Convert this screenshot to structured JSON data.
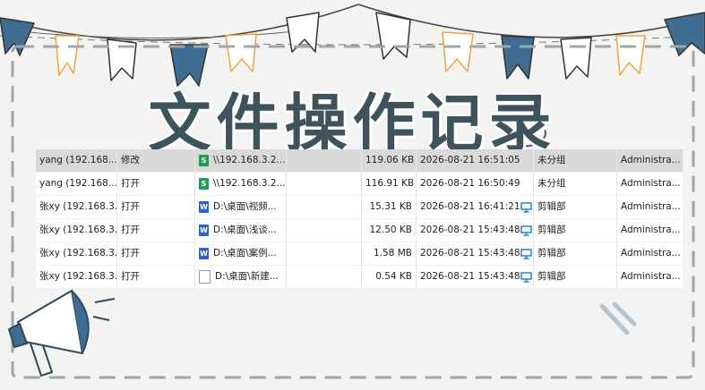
{
  "title": "文件操作记录",
  "colors": {
    "title": "#3e535b",
    "flag_dark": "#3f6d92",
    "flag_orange": "#f2a43f",
    "dash": "#9fa7ab",
    "row_selected": "#d9d9d9",
    "computer_icon": "#1e88d0"
  },
  "rows": [
    {
      "user": "yang (192.168....",
      "op": "修改",
      "icon": "xls",
      "icon_text": "S",
      "path": "\\\\192.168.3.2...",
      "size": "119.06 KB",
      "time": "2026-08-21 16:51:05",
      "computer_icon": false,
      "group": "未分组",
      "admin": "Administra...",
      "selected": true
    },
    {
      "user": "yang (192.168....",
      "op": "打开",
      "icon": "xls",
      "icon_text": "S",
      "path": "\\\\192.168.3.2...",
      "size": "116.91 KB",
      "time": "2026-08-21 16:50:49",
      "computer_icon": false,
      "group": "未分组",
      "admin": "Administra...",
      "selected": false
    },
    {
      "user": "张xy (192.168.3...",
      "op": "打开",
      "icon": "doc",
      "icon_text": "W",
      "path": "D:\\桌面\\视频...",
      "size": "15.31 KB",
      "time": "2026-08-21 16:41:21",
      "computer_icon": true,
      "group": "剪辑部",
      "admin": "Administra...",
      "selected": false
    },
    {
      "user": "张xy (192.168.3...",
      "op": "打开",
      "icon": "doc",
      "icon_text": "W",
      "path": "D:\\桌面\\浅谈...",
      "size": "12.50 KB",
      "time": "2026-08-21 15:43:48",
      "computer_icon": true,
      "group": "剪辑部",
      "admin": "Administra...",
      "selected": false
    },
    {
      "user": "张xy (192.168.3...",
      "op": "打开",
      "icon": "doc",
      "icon_text": "W",
      "path": "D:\\桌面\\案例...",
      "size": "1.58 MB",
      "time": "2026-08-21 15:43:48",
      "computer_icon": true,
      "group": "剪辑部",
      "admin": "Administra...",
      "selected": false
    },
    {
      "user": "张xy (192.168.3...",
      "op": "打开",
      "icon": "txt",
      "icon_text": "",
      "path": "D:\\桌面\\新建...",
      "size": "0.54 KB",
      "time": "2026-08-21 15:43:48",
      "computer_icon": true,
      "group": "剪辑部",
      "admin": "Administra...",
      "selected": false
    }
  ]
}
